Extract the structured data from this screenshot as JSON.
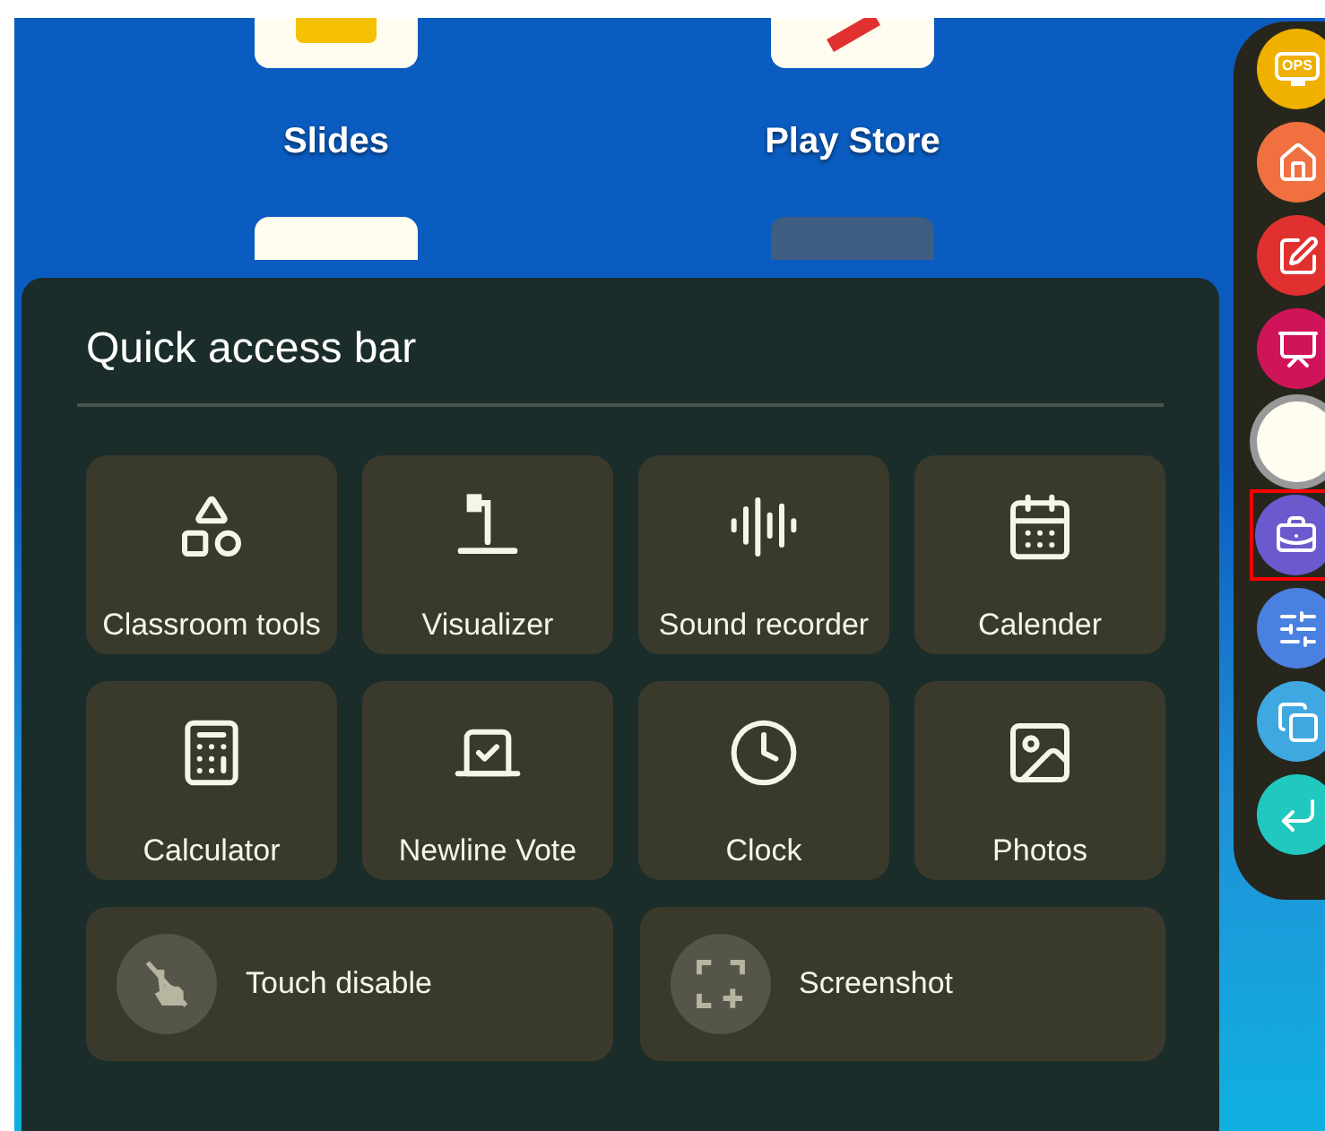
{
  "home_apps": [
    {
      "label": "Slides",
      "kind": "slides"
    },
    {
      "label": "Play Store",
      "kind": "store"
    }
  ],
  "quick_access_bar": {
    "title": "Quick access bar",
    "tiles": [
      {
        "label": "Classroom tools",
        "kind": "shapes"
      },
      {
        "label": "Visualizer",
        "kind": "visualizer"
      },
      {
        "label": "Sound recorder",
        "kind": "sound"
      },
      {
        "label": "Calender",
        "kind": "calendar"
      },
      {
        "label": "Calculator",
        "kind": "calculator"
      },
      {
        "label": "Newline Vote",
        "kind": "vote"
      },
      {
        "label": "Clock",
        "kind": "clock"
      },
      {
        "label": "Photos",
        "kind": "photos"
      }
    ],
    "toggles": [
      {
        "label": "Touch disable",
        "kind": "touch"
      },
      {
        "label": "Screenshot",
        "kind": "screenshot"
      }
    ]
  },
  "side_toolbar": [
    {
      "kind": "ops",
      "label": "OPS",
      "selected": false
    },
    {
      "kind": "home",
      "selected": false
    },
    {
      "kind": "note",
      "selected": false
    },
    {
      "kind": "present",
      "selected": false
    },
    {
      "kind": "circle",
      "selected": false
    },
    {
      "kind": "toolbox",
      "selected": true
    },
    {
      "kind": "settings",
      "selected": false
    },
    {
      "kind": "windows",
      "selected": false
    },
    {
      "kind": "back",
      "selected": false
    }
  ]
}
